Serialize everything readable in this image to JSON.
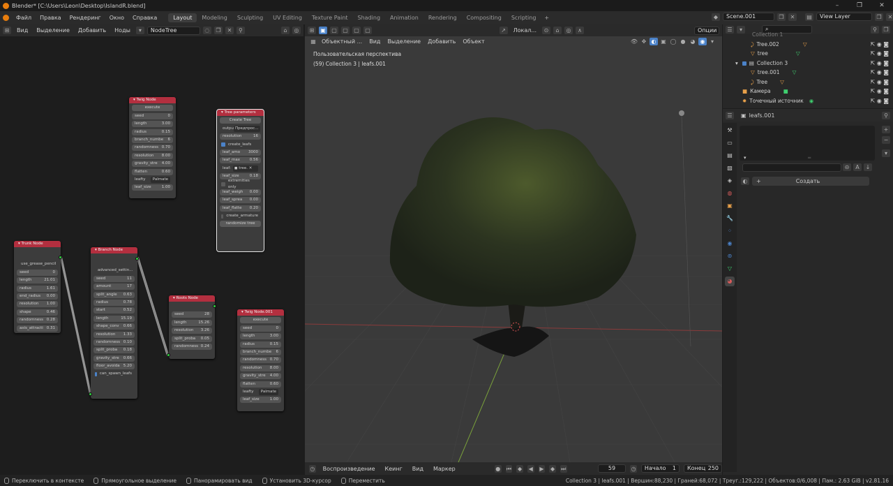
{
  "window": {
    "title": "Blender* [C:\\Users\\Leon\\Desktop\\IslandR.blend]",
    "controls": [
      "–",
      "❐",
      "✕"
    ]
  },
  "menu": {
    "items": [
      "Файл",
      "Правка",
      "Рендеринг",
      "Окно",
      "Справка"
    ],
    "workspaces": [
      "Layout",
      "Modeling",
      "Sculpting",
      "UV Editing",
      "Texture Paint",
      "Shading",
      "Animation",
      "Rendering",
      "Compositing",
      "Scripting"
    ],
    "active_workspace": "Layout",
    "add_tab": "+",
    "scene": "Scene.001",
    "view_layer": "View Layer"
  },
  "node_editor": {
    "header": {
      "menus": [
        "Вид",
        "Выделение",
        "Добавить",
        "Ноды"
      ],
      "tree_name": "NodeTree"
    },
    "nodes": {
      "twig": {
        "title": "Twig Node",
        "button": "execute",
        "fields": [
          [
            "seed",
            "0"
          ],
          [
            "length",
            "3.00"
          ],
          [
            "radius",
            "0.15"
          ],
          [
            "branch_numbe",
            "6"
          ],
          [
            "randomness",
            "0.70"
          ],
          [
            "resolution",
            "8.00"
          ],
          [
            "gravity_stre",
            "4.00"
          ],
          [
            "flatten",
            "0.60"
          ]
        ],
        "leaf_type_label": "leafty",
        "leaf_type_value": "Palmate",
        "leaf_size": [
          "leaf_size",
          "1.00"
        ]
      },
      "tree_params": {
        "title": "Tree parameters",
        "button": "Create Tree",
        "output_label": "outpu",
        "output_value": "Предпрос...",
        "resolution": [
          "resolution",
          "16"
        ],
        "create_leafs": "create_leafs",
        "fields": [
          [
            "leaf_amo",
            "3000"
          ],
          [
            "leaf_max",
            "0.56"
          ]
        ],
        "leaf_label": "leaf:",
        "leaf_value": "tree.",
        "leaf_size": [
          "leaf_size",
          "0.18"
        ],
        "extremities": "extremities only",
        "fields2": [
          [
            "leaf_weigh",
            "0.00"
          ],
          [
            "leaf_sprea",
            "0.00"
          ],
          [
            "leaf_flatte",
            "0.20"
          ]
        ],
        "create_armature": "create_armature",
        "randomize": "randomize tree"
      },
      "trunk": {
        "title": "Trunk Node",
        "checkbox": "use_grease_pencil",
        "fields": [
          [
            "seed",
            "0"
          ],
          [
            "length",
            "21.01"
          ],
          [
            "radius",
            "1.61"
          ],
          [
            "end_radius",
            "0.00"
          ],
          [
            "resolution",
            "1.00"
          ],
          [
            "shape",
            "0.46"
          ],
          [
            "randomness",
            "0.28"
          ],
          [
            "axis_attracti",
            "0.31"
          ]
        ]
      },
      "branch": {
        "title": "Branch Node",
        "checkbox": "advanced_settin...",
        "fields": [
          [
            "seed",
            "11"
          ],
          [
            "amount",
            "17"
          ],
          [
            "split_angle",
            "0.63"
          ],
          [
            "radius",
            "0.78"
          ],
          [
            "start",
            "0.52"
          ],
          [
            "length",
            "15.19"
          ],
          [
            "shape_conv",
            "0.66"
          ],
          [
            "resolution",
            "1.33"
          ],
          [
            "randomness",
            "0.10"
          ],
          [
            "split_proba",
            "0.18"
          ],
          [
            "gravity_stre",
            "0.66"
          ],
          [
            "floor_avoida",
            "5.20"
          ]
        ],
        "checkbox2": "can_spawn_leafs"
      },
      "roots": {
        "title": "Roots Node",
        "fields": [
          [
            "seed",
            "28"
          ],
          [
            "length",
            "15.26"
          ],
          [
            "resolution",
            "3.26"
          ],
          [
            "split_proba",
            "0.05"
          ],
          [
            "randomness",
            "0.24"
          ]
        ]
      },
      "twig001": {
        "title": "Twig Node.001",
        "button": "execute",
        "fields": [
          [
            "seed",
            "0"
          ],
          [
            "length",
            "3.00"
          ],
          [
            "radius",
            "0.15"
          ],
          [
            "branch_numbe",
            "6"
          ],
          [
            "randomness",
            "0.70"
          ],
          [
            "resolution",
            "8.00"
          ],
          [
            "gravity_stre",
            "4.00"
          ],
          [
            "flatten",
            "0.60"
          ]
        ],
        "leaf_type_label": "leafty",
        "leaf_type_value": "Palmate",
        "leaf_size": [
          "leaf_size",
          "1.00"
        ]
      }
    }
  },
  "viewport": {
    "header": {
      "mode": "Объектный ...",
      "transform": "Локал...",
      "options": "Опции",
      "menus": [
        "Вид",
        "Выделение",
        "Добавить",
        "Объект"
      ]
    },
    "info_line1": "Пользовательская перспектива",
    "info_line2": "(59) Collection 3 | leafs.001"
  },
  "outliner": {
    "rows": [
      "Collection 1",
      "Tree.002",
      "tree",
      "Collection 3",
      "tree.001",
      "Tree",
      "Камера",
      "Точечный источник"
    ]
  },
  "properties": {
    "object_name": "leafs.001",
    "create_button": "Создать"
  },
  "timeline": {
    "menus": [
      "Воспроизведение",
      "Кеинг",
      "Вид",
      "Маркер"
    ],
    "current_frame": "59",
    "start_label": "Начало",
    "start_value": "1",
    "end_label": "Конец",
    "end_value": "250"
  },
  "statusbar": {
    "items": [
      "Переключить в контексте",
      "Прямоугольное выделение",
      "Панорамировать вид",
      "Установить 3D-курсор",
      "Переместить"
    ],
    "stats": "Collection 3 | leafs.001 | Вершин:88,230 | Граней:68,072 | Треуг.:129,222 | Объектов:0/6,008 | Пам.: 2.63 GiB | v2.81.16"
  },
  "colors": {
    "node_header": "#b32f3f",
    "socket": "#2fd03f",
    "accent_blue": "#4b82c8",
    "blender_orange": "#e87d0d"
  }
}
